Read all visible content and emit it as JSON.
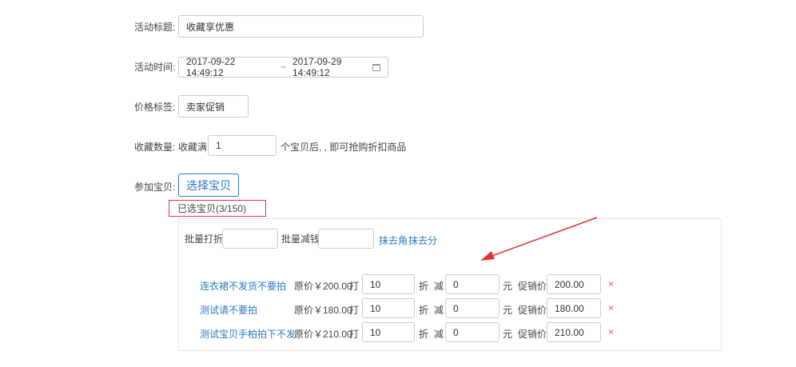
{
  "form": {
    "title_label": "活动标题:",
    "title_value": "收藏享优惠",
    "time_label": "活动时间:",
    "time_start": "2017-09-22 14:49:12",
    "time_separator": "~",
    "time_end": "2017-09-29 14:49:12",
    "price_tag_label": "价格标签:",
    "price_tag_value": "卖家促销",
    "collect_count_label": "收藏数量:",
    "collect_prefix": "收藏满",
    "collect_value": "1",
    "collect_suffix": "个宝贝后, , 即可抢购折扣商品",
    "items_label": "参加宝贝:",
    "select_button": "选择宝贝",
    "selected_count": "已选宝贝(3/150)"
  },
  "batch": {
    "discount_label": "批量打折",
    "discount_value": "",
    "reduce_label": "批量减钱",
    "reduce_value": "",
    "round_jiao": "抹去角",
    "round_fen": "抹去分"
  },
  "labels": {
    "discount": "打",
    "zhe": "折",
    "minus": "减",
    "yuan": "元",
    "promo_price": "促销价",
    "remove": "×"
  },
  "products": [
    {
      "name": "连衣裙不发货不要拍",
      "original_price": "原价￥200.00",
      "discount": "10",
      "reduce": "0",
      "promo": "200.00"
    },
    {
      "name": "测试请不要拍",
      "original_price": "原价￥180.00",
      "discount": "10",
      "reduce": "0",
      "promo": "180.00"
    },
    {
      "name": "测试宝贝手柏拍下不发",
      "original_price": "原价￥210.00",
      "discount": "10",
      "reduce": "0",
      "promo": "210.00"
    }
  ],
  "colors": {
    "link": "#2b78c5",
    "annotation_red": "#e33333"
  },
  "icons": [
    "calendar-icon",
    "close-icon"
  ]
}
